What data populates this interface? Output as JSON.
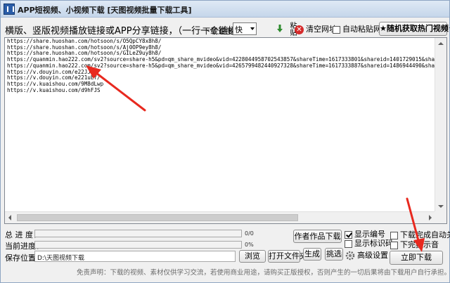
{
  "window": {
    "title": "APP短视频、小视频下载 [天图视频批量下载工具]"
  },
  "toolbar": {
    "hint": "横版、竖版视频播放链接或APP分享链接，（一行一个链接）",
    "speed_label": "下载速度:",
    "speed_value": "快",
    "paste_label": "粘贴",
    "clear_label": "清空网址",
    "auto_paste_label": "自动粘贴网址",
    "auto_paste_checked": false,
    "hot_button": "★随机获取热门视频★"
  },
  "links": [
    "https://share.huoshan.com/hotsoon/s/O5QpCY8x8h8/",
    "https://share.huoshan.com/hotsoon/s/Aj0OP9ey8h8/",
    "https://share.huoshan.com/hotsoon/s/GILeZ9uy8h8/",
    "https://quanmin.hao222.com/sv2?source=share-h5&pd=qm_share_mvideo&vid=4228044958702543857&shareTime=1617333801&shareid=1401729015&shared_cuid=_uSPt0iZSfYuaMiMg8v",
    "https://quanmin.hao222.com/sv2?source=share-h5&pd=qm_share_mvideo&vid=4265799482440927328&shareTime=1617333887&shareid=1486944490&shared_cuid=_uSPt0iZSfYuaMiMg8v",
    "https://v.douyin.com/e22JJKm/",
    "https://v.douyin.com/e221uEf/",
    "https://v.kuaishou.com/9M8dLwp",
    "https://v.kuaishou.com/d9hFJS"
  ],
  "bottom": {
    "total_progress_label": "总  进  度：",
    "total_progress_count": "0/0",
    "total_progress_fraction": 0,
    "current_progress_label": "当前进度：",
    "current_progress_count": "0%",
    "current_progress_fraction": 0,
    "save_path_label": "保存位置：",
    "save_path_value": "D:\\天图视频下载",
    "browse_button": "浏览",
    "open_folder_button": "打开文件夹",
    "author_button": "作者作品下载",
    "generate_button": "生成",
    "pick_button": "挑选",
    "show_number_label": "显示编号",
    "show_number_checked": true,
    "show_mark_label": "显示标识码",
    "show_mark_checked": false,
    "advanced_label": "高级设置",
    "auto_shutdown_label": "下载完成自动关机",
    "auto_shutdown_checked": false,
    "beep_label": "下完提示音",
    "beep_checked": false,
    "start_button": "立即下载",
    "disclaimer": "免责声明：下载的视频、素材仅供学习交流，若使用商业用途，请购买正版授权，否则产生的一切后果将由下载用户自行承担。"
  },
  "colors": {
    "progress_fill": "#06b025",
    "annotation_arrow": "#e8291f"
  }
}
